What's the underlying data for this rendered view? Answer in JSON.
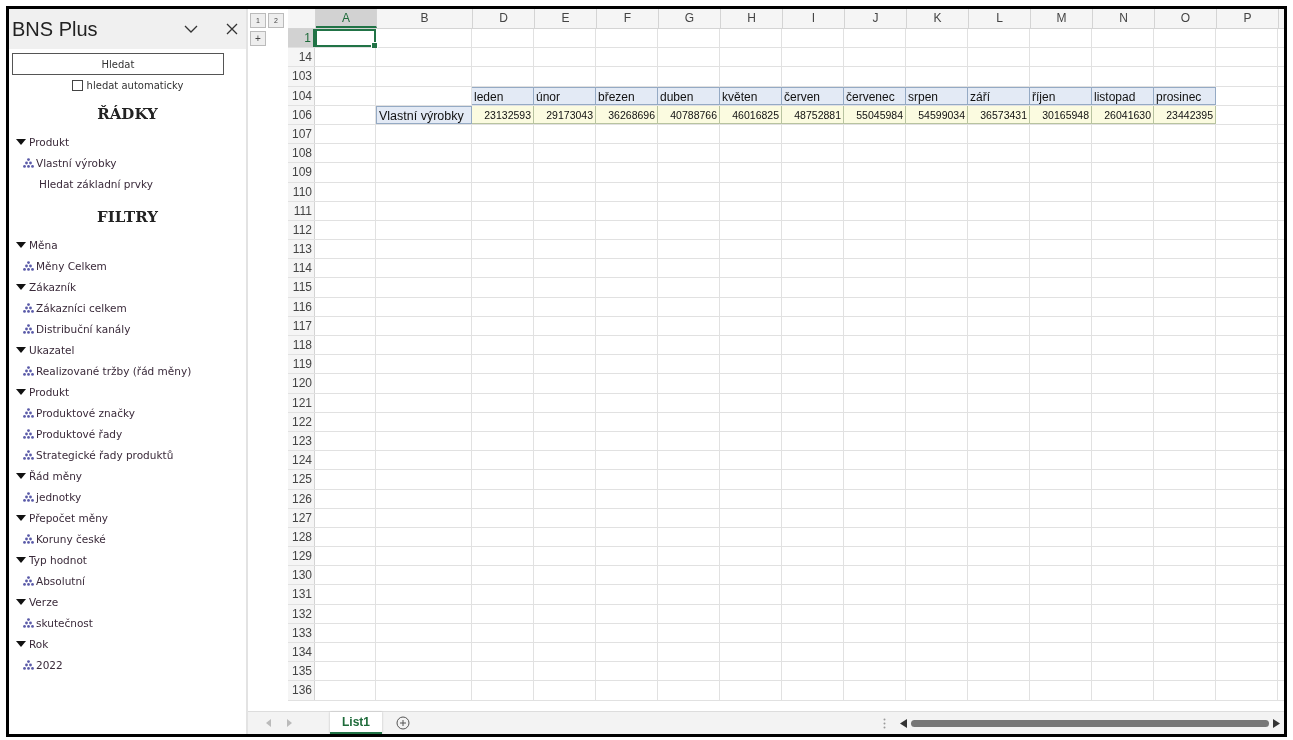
{
  "sidebar": {
    "title": "BNS Plus",
    "search_button": "Hledat",
    "auto_search": {
      "label": "hledat automaticky",
      "checked": false
    },
    "sections": [
      {
        "heading": "ŘÁDKY",
        "groups": [
          {
            "label": "Produkt",
            "expanded": true,
            "children": [
              {
                "label": "Vlastní výrobky",
                "kind": "member"
              },
              {
                "label": "Hledat základní prvky",
                "kind": "action"
              }
            ]
          }
        ]
      },
      {
        "heading": "FILTRY",
        "groups": [
          {
            "label": "Měna",
            "expanded": true,
            "children": [
              {
                "label": "Měny Celkem",
                "kind": "member"
              }
            ]
          },
          {
            "label": "Zákazník",
            "expanded": true,
            "children": [
              {
                "label": "Zákazníci celkem",
                "kind": "member"
              },
              {
                "label": "Distribuční kanály",
                "kind": "member"
              }
            ]
          },
          {
            "label": "Ukazatel",
            "expanded": true,
            "children": [
              {
                "label": "Realizované tržby (řád měny)",
                "kind": "member"
              }
            ]
          },
          {
            "label": "Produkt",
            "expanded": true,
            "children": [
              {
                "label": "Produktové značky",
                "kind": "member"
              },
              {
                "label": "Produktové řady",
                "kind": "member"
              },
              {
                "label": "Strategické řady produktů",
                "kind": "member"
              }
            ]
          },
          {
            "label": "Řád měny",
            "expanded": true,
            "children": [
              {
                "label": "jednotky",
                "kind": "member"
              }
            ]
          },
          {
            "label": "Přepočet měny",
            "expanded": true,
            "children": [
              {
                "label": "Koruny české",
                "kind": "member"
              }
            ]
          },
          {
            "label": "Typ hodnot",
            "expanded": true,
            "children": [
              {
                "label": "Absolutní",
                "kind": "member"
              }
            ]
          },
          {
            "label": "Verze",
            "expanded": true,
            "children": [
              {
                "label": "skutečnost",
                "kind": "member"
              }
            ]
          },
          {
            "label": "Rok",
            "expanded": true,
            "children": [
              {
                "label": "2022",
                "kind": "member"
              }
            ]
          }
        ]
      }
    ]
  },
  "sheet": {
    "outline_levels": [
      "1",
      "2"
    ],
    "outline_toggle": "+",
    "columns": [
      {
        "label": "A",
        "selected": true
      },
      {
        "label": "B",
        "selected": false
      },
      {
        "label": "D",
        "selected": false
      },
      {
        "label": "E",
        "selected": false
      },
      {
        "label": "F",
        "selected": false
      },
      {
        "label": "G",
        "selected": false
      },
      {
        "label": "H",
        "selected": false
      },
      {
        "label": "I",
        "selected": false
      },
      {
        "label": "J",
        "selected": false
      },
      {
        "label": "K",
        "selected": false
      },
      {
        "label": "L",
        "selected": false
      },
      {
        "label": "M",
        "selected": false
      },
      {
        "label": "N",
        "selected": false
      },
      {
        "label": "O",
        "selected": false
      },
      {
        "label": "P",
        "selected": false
      }
    ],
    "pivot": {
      "months": [
        "leden",
        "únor",
        "březen",
        "duben",
        "květen",
        "červen",
        "červenec",
        "srpen",
        "září",
        "říjen",
        "listopad",
        "prosinec"
      ],
      "row_label": "Vlastní výrobky",
      "values": [
        "23132593",
        "29173043",
        "36268696",
        "40788766",
        "46016825",
        "48752881",
        "55045984",
        "54599034",
        "36573431",
        "30165948",
        "26041630",
        "23442395"
      ]
    },
    "rows": [
      {
        "header": "1",
        "kind": "blank",
        "selected": true
      },
      {
        "header": "14",
        "kind": "blank",
        "selected": false
      },
      {
        "header": "103",
        "kind": "blank",
        "selected": false
      },
      {
        "header": "104",
        "kind": "months",
        "selected": false
      },
      {
        "header": "106",
        "kind": "values",
        "selected": false
      },
      {
        "header": "107",
        "kind": "blank",
        "selected": false
      },
      {
        "header": "108",
        "kind": "blank",
        "selected": false
      },
      {
        "header": "109",
        "kind": "blank",
        "selected": false
      },
      {
        "header": "110",
        "kind": "blank",
        "selected": false
      },
      {
        "header": "111",
        "kind": "blank",
        "selected": false
      },
      {
        "header": "112",
        "kind": "blank",
        "selected": false
      },
      {
        "header": "113",
        "kind": "blank",
        "selected": false
      },
      {
        "header": "114",
        "kind": "blank",
        "selected": false
      },
      {
        "header": "115",
        "kind": "blank",
        "selected": false
      },
      {
        "header": "116",
        "kind": "blank",
        "selected": false
      },
      {
        "header": "117",
        "kind": "blank",
        "selected": false
      },
      {
        "header": "118",
        "kind": "blank",
        "selected": false
      },
      {
        "header": "119",
        "kind": "blank",
        "selected": false
      },
      {
        "header": "120",
        "kind": "blank",
        "selected": false
      },
      {
        "header": "121",
        "kind": "blank",
        "selected": false
      },
      {
        "header": "122",
        "kind": "blank",
        "selected": false
      },
      {
        "header": "123",
        "kind": "blank",
        "selected": false
      },
      {
        "header": "124",
        "kind": "blank",
        "selected": false
      },
      {
        "header": "125",
        "kind": "blank",
        "selected": false
      },
      {
        "header": "126",
        "kind": "blank",
        "selected": false
      },
      {
        "header": "127",
        "kind": "blank",
        "selected": false
      },
      {
        "header": "128",
        "kind": "blank",
        "selected": false
      },
      {
        "header": "129",
        "kind": "blank",
        "selected": false
      },
      {
        "header": "130",
        "kind": "blank",
        "selected": false
      },
      {
        "header": "131",
        "kind": "blank",
        "selected": false
      },
      {
        "header": "132",
        "kind": "blank",
        "selected": false
      },
      {
        "header": "133",
        "kind": "blank",
        "selected": false
      },
      {
        "header": "134",
        "kind": "blank",
        "selected": false
      },
      {
        "header": "135",
        "kind": "blank",
        "selected": false
      },
      {
        "header": "136",
        "kind": "blank",
        "selected": false
      }
    ],
    "tabs": [
      {
        "label": "List1",
        "selected": true
      }
    ]
  }
}
